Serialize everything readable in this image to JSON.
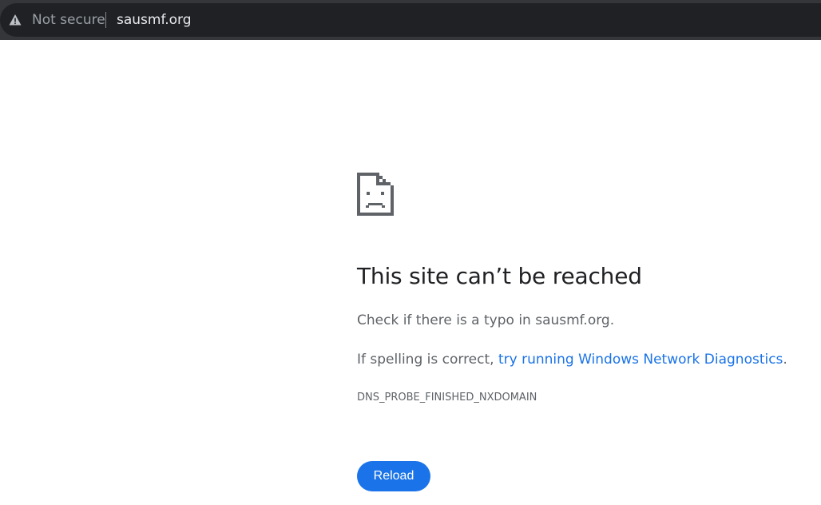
{
  "address_bar": {
    "security_icon": "warning-triangle-icon",
    "security_label": "Not secure",
    "url": "sausmf.org"
  },
  "error_page": {
    "icon": "sad-page-icon",
    "heading": "This site can’t be reached",
    "check_message": "Check if there is a typo in sausmf.org.",
    "spelling_prefix": "If spelling is correct, ",
    "diagnostics_link": "try running Windows Network Diagnostics",
    "spelling_suffix": ".",
    "error_code": "DNS_PROBE_FINISHED_NXDOMAIN",
    "reload_label": "Reload"
  },
  "colors": {
    "toolbar": "#35363a",
    "omnibox": "#202124",
    "link": "#1a73e8",
    "button": "#1a73e8",
    "heading": "#202124",
    "text": "#5f6368"
  }
}
